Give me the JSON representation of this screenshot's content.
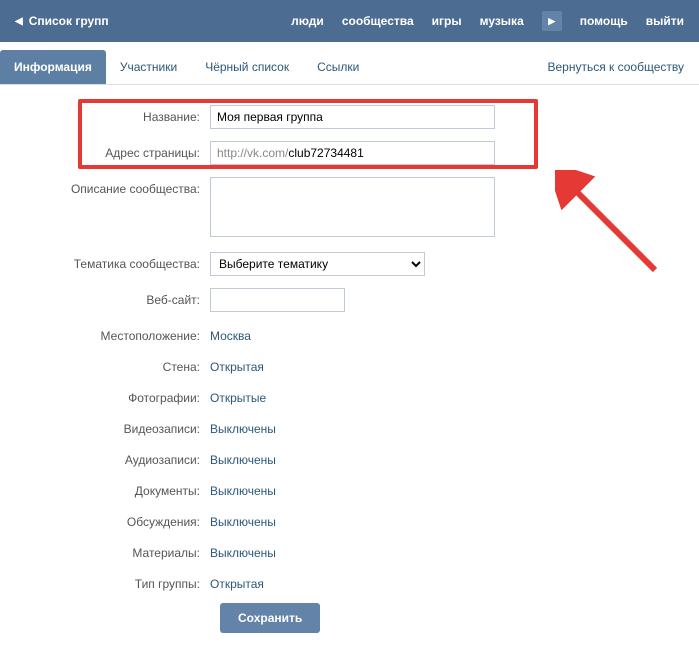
{
  "topnav": {
    "back_label": "Список групп",
    "items": [
      "люди",
      "сообщества",
      "игры",
      "музыка"
    ],
    "help": "помощь",
    "logout": "выйти"
  },
  "tabs": {
    "items": [
      "Информация",
      "Участники",
      "Чёрный список",
      "Ссылки"
    ],
    "active": 0,
    "back": "Вернуться к сообществу"
  },
  "form": {
    "name_label": "Название:",
    "name_value": "Моя первая группа",
    "url_label": "Адрес страницы:",
    "url_prefix": "http://vk.com/",
    "url_value": "club72734481",
    "desc_label": "Описание сообщества:",
    "desc_value": "",
    "topic_label": "Тематика сообщества:",
    "topic_value": "Выберите тематику",
    "website_label": "Веб-сайт:",
    "website_value": "",
    "rows": [
      {
        "label": "Местоположение:",
        "value": "Москва"
      },
      {
        "label": "Стена:",
        "value": "Открытая"
      },
      {
        "label": "Фотографии:",
        "value": "Открытые"
      },
      {
        "label": "Видеозаписи:",
        "value": "Выключены"
      },
      {
        "label": "Аудиозаписи:",
        "value": "Выключены"
      },
      {
        "label": "Документы:",
        "value": "Выключены"
      },
      {
        "label": "Обсуждения:",
        "value": "Выключены"
      },
      {
        "label": "Материалы:",
        "value": "Выключены"
      },
      {
        "label": "Тип группы:",
        "value": "Открытая"
      }
    ],
    "save": "Сохранить"
  }
}
